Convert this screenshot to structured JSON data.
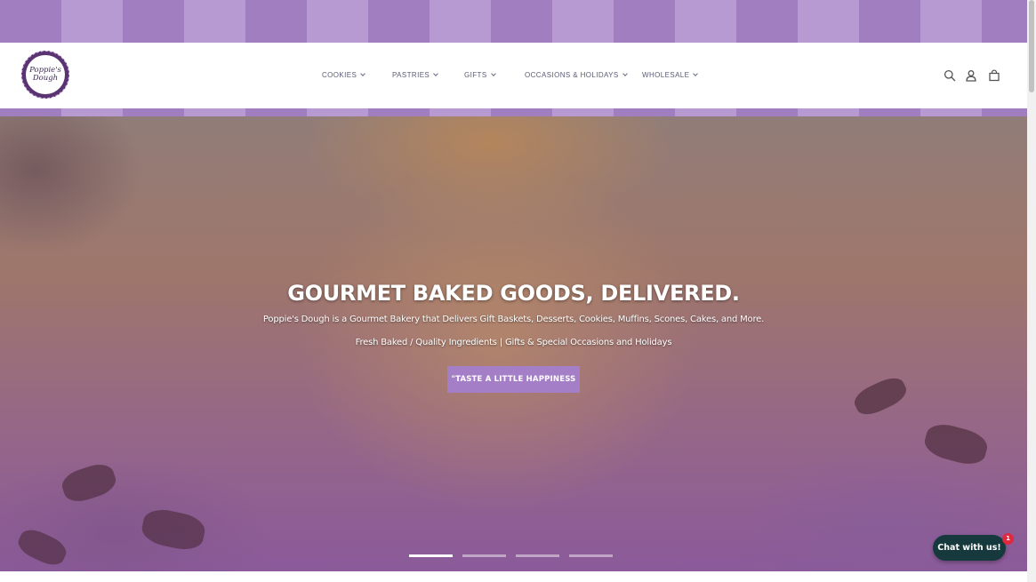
{
  "brand": {
    "logo_text": "Poppie's Dough"
  },
  "nav": {
    "items": [
      {
        "label": "COOKIES"
      },
      {
        "label": "PASTRIES"
      },
      {
        "label": "GIFTS"
      },
      {
        "label": "OCCASIONS & HOLIDAYS"
      },
      {
        "label": "WHOLESALE"
      }
    ]
  },
  "header_icons": [
    "search-icon",
    "account-icon",
    "cart-icon"
  ],
  "hero": {
    "title": "GOURMET BAKED GOODS, DELIVERED.",
    "subtitle": "Poppie's Dough is a Gourmet Bakery that Delivers Gift Baskets, Desserts, Cookies, Muffins, Scones, Cakes, and More.",
    "tagline": "Fresh Baked / Quality Ingredients | Gifts & Special Occasions and Holidays",
    "cta_label": "\"TASTE A LITTLE HAPPINESS",
    "slide_count": 4,
    "active_slide": 1
  },
  "chat": {
    "label": "Chat with us!",
    "badge_count": "1"
  },
  "colors": {
    "accent": "#a47ec6",
    "stripe_dark": "#a07ec0",
    "stripe_light": "#b79ad2",
    "nav_text": "#5b5b77",
    "chat_bg": "#15393c",
    "badge": "#e0283e"
  }
}
